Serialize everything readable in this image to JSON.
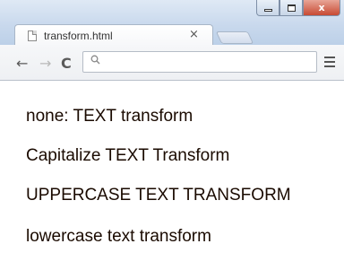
{
  "tab": {
    "title": "transform.html",
    "close_glyph": "×"
  },
  "window_controls": {
    "minimize": "minimize",
    "maximize": "maximize",
    "close_glyph": "x"
  },
  "toolbar": {
    "back_glyph": "←",
    "forward_glyph": "→",
    "reload_glyph": "C",
    "search_icon": "search-icon",
    "address_value": "",
    "menu_icon": "menu-icon"
  },
  "page": {
    "lines": [
      "none: TEXT transform",
      "Capitalize TEXT Transform",
      "UPPERCASE TEXT TRANSFORM",
      "lowercase text transform"
    ]
  }
}
